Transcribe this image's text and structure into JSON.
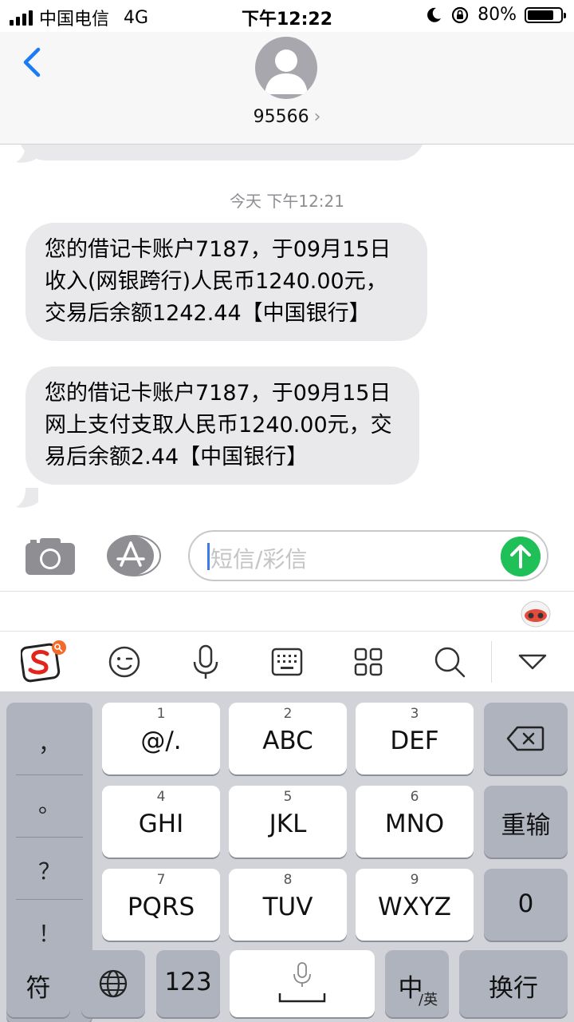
{
  "status_bar": {
    "carrier": "中国电信",
    "network": "4G",
    "time": "下午12:22",
    "battery_percent": "80%",
    "battery_level": 0.8
  },
  "header": {
    "contact_number": "95566",
    "chevron": "›"
  },
  "conversation": {
    "timestamp": "今天 下午12:21",
    "messages": [
      {
        "text": "您的借记卡账户7187，于09月15日收入(网银跨行)人民币1240.00元，交易后余额1242.44【中国银行】"
      },
      {
        "text": "您的借记卡账户7187，于09月15日网上支付支取人民币1240.00元，交易后余额2.44【中国银行】"
      }
    ]
  },
  "input": {
    "placeholder": "短信/彩信"
  },
  "keyboard": {
    "punctuation": [
      "，",
      "。",
      "？",
      "！"
    ],
    "rows": [
      [
        {
          "num": "1",
          "label": "@/."
        },
        {
          "num": "2",
          "label": "ABC"
        },
        {
          "num": "3",
          "label": "DEF"
        }
      ],
      [
        {
          "num": "4",
          "label": "GHI"
        },
        {
          "num": "5",
          "label": "JKL"
        },
        {
          "num": "6",
          "label": "MNO"
        }
      ],
      [
        {
          "num": "7",
          "label": "PQRS"
        },
        {
          "num": "8",
          "label": "TUV"
        },
        {
          "num": "9",
          "label": "WXYZ"
        }
      ]
    ],
    "retype": "重输",
    "zero": "0",
    "symbols": "符",
    "num123": "123",
    "lang_main": "中",
    "lang_sub": "/英",
    "enter": "换行"
  },
  "colors": {
    "bubble": "#e9e9eb",
    "send": "#1fc057",
    "back": "#1a7cf5",
    "keyboard_bg": "#d1d3d9",
    "dark_key": "#aeb3be"
  },
  "icons": {
    "back": "chevron-left-icon",
    "camera": "camera-icon",
    "appstore": "app-store-icon",
    "send": "arrow-up-icon",
    "sogou": "sogou-logo-icon",
    "emoji": "smiley-icon",
    "mic": "microphone-icon",
    "keyboard": "keyboard-icon",
    "apps": "grid-icon",
    "search": "search-icon",
    "hide": "triangle-down-icon",
    "delete": "backspace-icon",
    "globe": "globe-icon"
  }
}
